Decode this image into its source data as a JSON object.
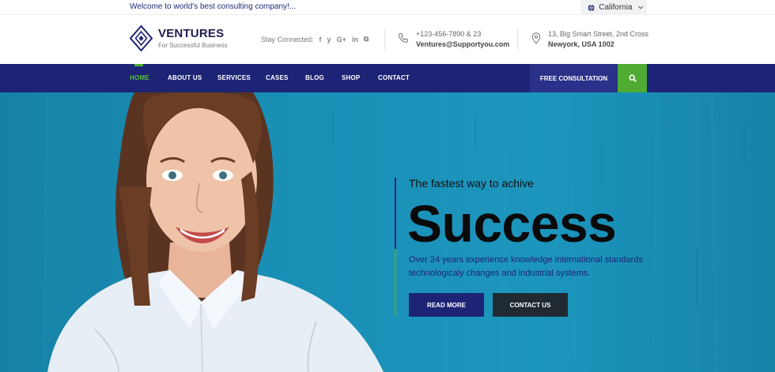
{
  "topbar": {
    "welcome": "Welcome to world's best consulting company!...",
    "location": "California"
  },
  "header": {
    "brand": "VENTURES",
    "tagline": "For Successful Business",
    "stay_connected": "Stay Connected:",
    "social": [
      "f",
      "y",
      "G+",
      "in",
      "⧉"
    ],
    "phone": "+123-456-7890 & 23",
    "email": "Ventures@Supportyou.com",
    "address_line1": "13, Big Smart Street, 2nd Cross",
    "address_line2": "Newyork, USA 1002"
  },
  "nav": {
    "items": [
      "HOME",
      "ABOUT US",
      "SERVICES",
      "CASES",
      "BLOG",
      "SHOP",
      "CONTACT"
    ],
    "consultation": "FREE CONSULTATION"
  },
  "hero": {
    "pre_title": "The fastest way to achive",
    "title": "Success",
    "description": "Over 24 years experience knowledge international standards technologicaly changes and industrial systems.",
    "read_more": "READ MORE",
    "contact_us": "CONTACT US"
  },
  "colors": {
    "navy": "#1d2475",
    "green": "#4eac32",
    "hero_blue": "#1a8fb6"
  },
  "icons": [
    "globe-icon",
    "chevron-down-icon",
    "logo-diamond-icon",
    "phone-icon",
    "map-pin-icon",
    "search-icon"
  ]
}
